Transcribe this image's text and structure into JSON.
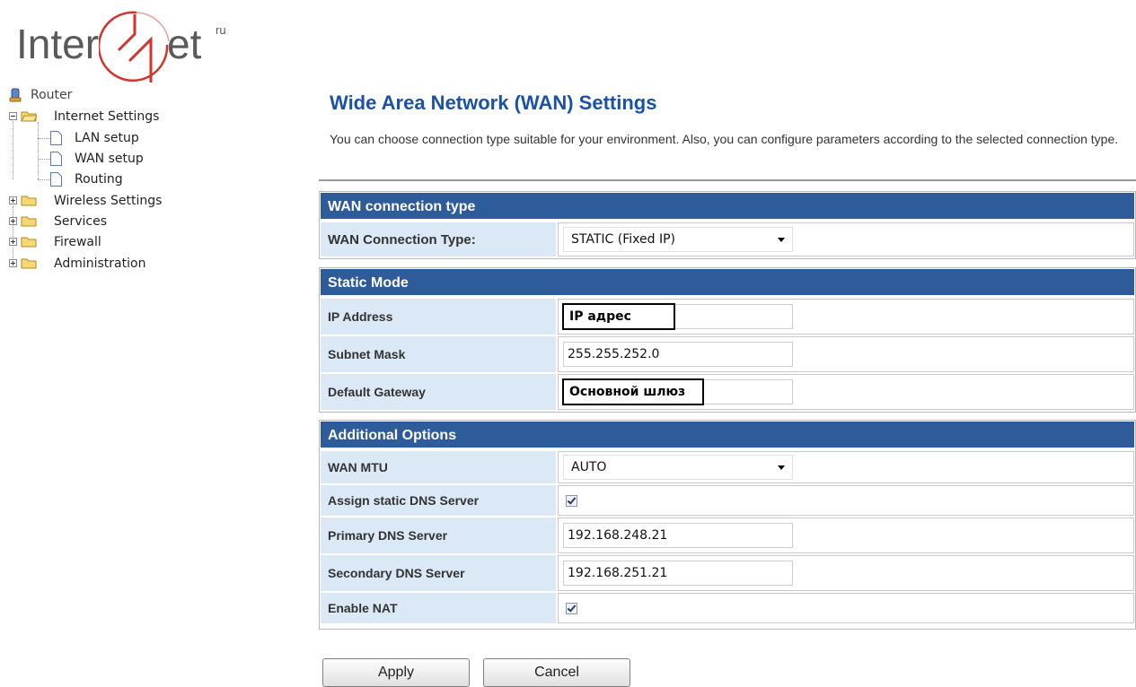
{
  "logo": {
    "text_left": "Inter",
    "text_right": "et",
    "superscript": "ru"
  },
  "tree": {
    "root": "Router",
    "items": [
      {
        "label": "Internet Settings",
        "expanded": true,
        "children": [
          {
            "label": "LAN setup"
          },
          {
            "label": "WAN setup"
          },
          {
            "label": "Routing"
          }
        ]
      },
      {
        "label": "Wireless Settings",
        "expanded": false
      },
      {
        "label": "Services",
        "expanded": false
      },
      {
        "label": "Firewall",
        "expanded": false
      },
      {
        "label": "Administration",
        "expanded": false
      }
    ]
  },
  "page": {
    "title": "Wide Area Network (WAN) Settings",
    "description": "You can choose connection type suitable for your environment. Also, you can configure parameters according to the selected connection type."
  },
  "wan_type": {
    "header": "WAN connection type",
    "label": "WAN Connection Type:",
    "value": "STATIC (Fixed IP)"
  },
  "static_mode": {
    "header": "Static Mode",
    "ip_label": "IP Address",
    "ip_value": "IP адрес",
    "mask_label": "Subnet Mask",
    "mask_value": "255.255.252.0",
    "gateway_label": "Default Gateway",
    "gateway_value": "Основной шлюз"
  },
  "additional": {
    "header": "Additional Options",
    "mtu_label": "WAN MTU",
    "mtu_value": "AUTO",
    "static_dns_label": "Assign static DNS Server",
    "static_dns_checked": true,
    "primary_dns_label": "Primary DNS Server",
    "primary_dns_value": "192.168.248.21",
    "secondary_dns_label": "Secondary DNS Server",
    "secondary_dns_value": "192.168.251.21",
    "nat_label": "Enable NAT",
    "nat_checked": true
  },
  "buttons": {
    "apply": "Apply",
    "cancel": "Cancel"
  },
  "colors": {
    "title": "#1a52a6",
    "header_bg": "#2e5b9a",
    "label_bg": "#dbe8f5",
    "logo_red": "#d4332b"
  }
}
